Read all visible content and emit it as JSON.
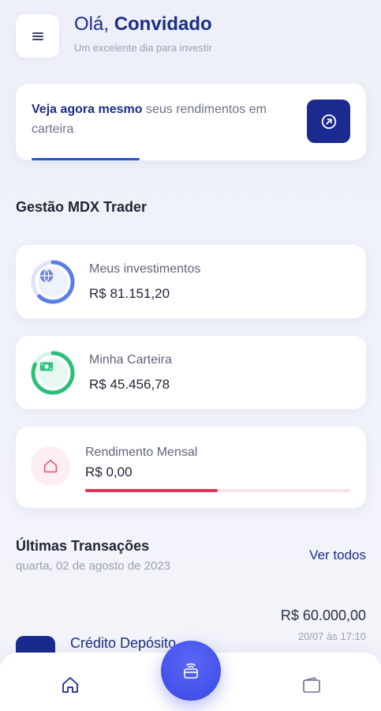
{
  "header": {
    "greeting_prefix": "Olá,",
    "greeting_name": "Convidado",
    "subtitle": "Um excelente dia para investir"
  },
  "promo": {
    "highlight": "Veja agora mesmo",
    "text": " seus rendimentos em carteira",
    "progress": 0.34
  },
  "section_title": "Gestão MDX Trader",
  "cards": {
    "investments": {
      "label": "Meus investimentos",
      "value": "R$ 81.151,20",
      "progress": 0.62,
      "color": "#5b7fe0",
      "track": "#dbe4fb",
      "icon": "globe-icon"
    },
    "wallet": {
      "label": "Minha Carteira",
      "value": "R$ 45.456,78",
      "progress": 0.82,
      "color": "#2dbf7a",
      "track": "#d6f3e5",
      "icon": "cash-icon"
    },
    "income": {
      "label": "Rendimento Mensal",
      "value": "R$ 0,00",
      "progress": 0.5,
      "color": "#e0345a",
      "icon": "home-icon"
    }
  },
  "transactions": {
    "title": "Últimas Transações",
    "date": "quarta, 02 de agosto de 2023",
    "see_all": "Ver todos",
    "items": [
      {
        "name": "Crédito Depósito",
        "amount": "R$ 60.000,00",
        "time": "20/07 às 17:10"
      }
    ]
  },
  "nav": {
    "items": [
      "home-icon",
      "wallet-icon"
    ],
    "fab_icon": "contactless-card-icon"
  }
}
